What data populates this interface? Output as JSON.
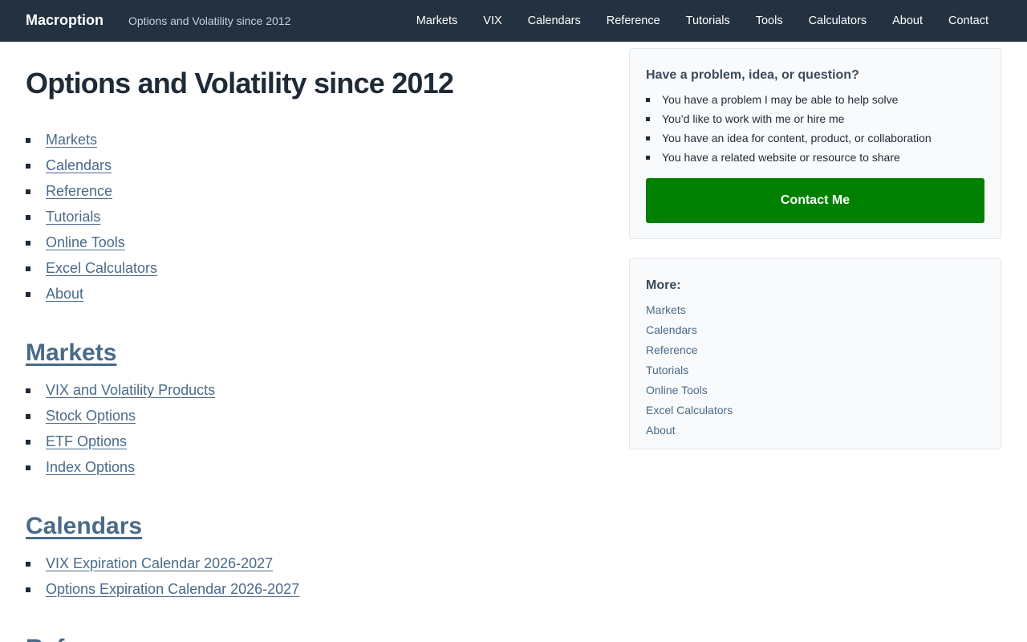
{
  "header": {
    "brand": "Macroption",
    "tagline": "Options and Volatility since 2012",
    "nav": [
      "Markets",
      "VIX",
      "Calendars",
      "Reference",
      "Tutorials",
      "Tools",
      "Calculators",
      "About",
      "Contact"
    ]
  },
  "main": {
    "title": "Options and Volatility since 2012",
    "toc": [
      "Markets",
      "Calendars",
      "Reference",
      "Tutorials",
      "Online Tools",
      "Excel Calculators",
      "About"
    ],
    "sections": [
      {
        "heading": "Markets",
        "links": [
          "VIX and Volatility Products",
          "Stock Options",
          "ETF Options",
          "Index Options"
        ]
      },
      {
        "heading": "Calendars",
        "links": [
          "VIX Expiration Calendar 2026-2027",
          "Options Expiration Calendar 2026-2027"
        ]
      },
      {
        "heading": "Reference",
        "links": []
      }
    ]
  },
  "sidebar": {
    "help": {
      "heading": "Have a problem, idea, or question?",
      "items": [
        "You have a problem I may be able to help solve",
        "You’d like to work with me or hire me",
        "You have an idea for content, product, or collaboration",
        "You have a related website or resource to share"
      ],
      "button_label": "Contact Me",
      "button_color": "#008000"
    },
    "more": {
      "heading": "More:",
      "links": [
        "Markets",
        "Calendars",
        "Reference",
        "Tutorials",
        "Online Tools",
        "Excel Calculators",
        "About"
      ]
    }
  },
  "colors": {
    "header_bg": "#233141",
    "link": "#4a6a8a",
    "text": "#1f2a37",
    "card_bg": "#f8fafc"
  }
}
